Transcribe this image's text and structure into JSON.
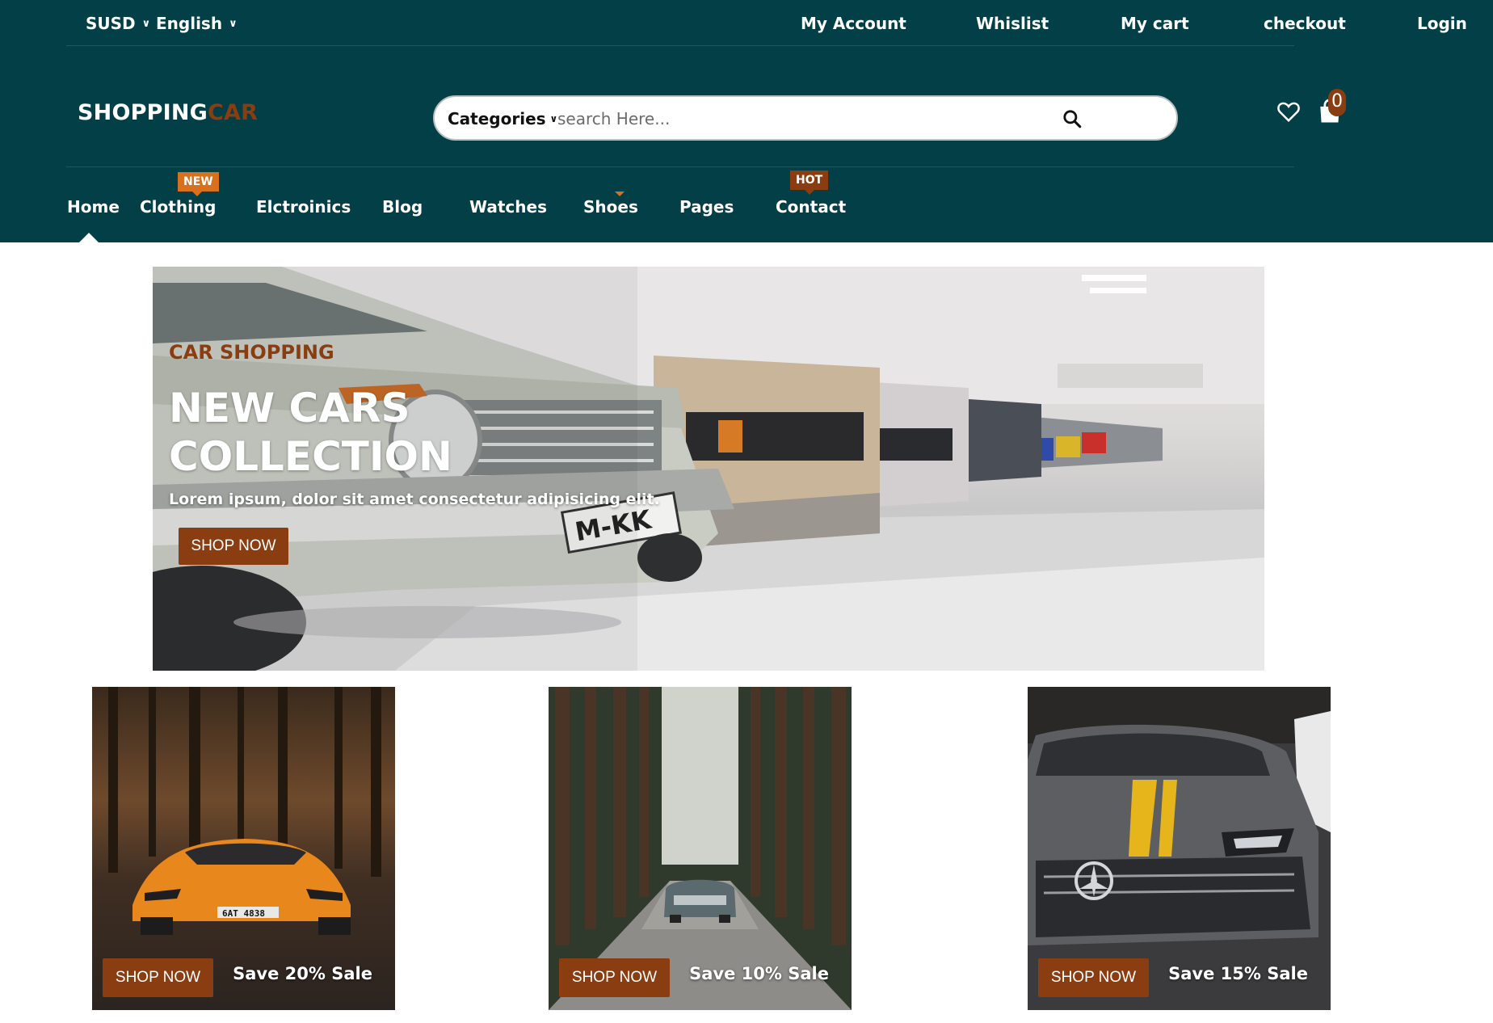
{
  "topbar": {
    "currency": "SUSD",
    "language": "English",
    "links": [
      "My Account",
      "Whislist",
      "My cart",
      "checkout",
      "Login"
    ]
  },
  "logo": {
    "part1": "SHOPPING",
    "part2": "CAR"
  },
  "search": {
    "category_label": "Categories",
    "placeholder": "search Here..."
  },
  "cart": {
    "count": "0"
  },
  "nav": {
    "items": [
      "Home",
      "Clothing",
      "Elctroinics",
      "Blog",
      "Watches",
      "Shoes",
      "Pages",
      "Contact"
    ],
    "new_tag": "NEW",
    "hot_tag": "HOT"
  },
  "hero": {
    "subtitle": "CAR SHOPPING",
    "title_line1": "NEW CARS",
    "title_line2": "COLLECTION",
    "text": "Lorem ipsum, dolor sit amet consectetur adipisicing elit.",
    "button": "SHOP NOW",
    "plate": "M-KK"
  },
  "cards": [
    {
      "button": "SHOP NOW",
      "sale": "Save 20% Sale",
      "plate": "6AT 4838"
    },
    {
      "button": "SHOP NOW",
      "sale": "Save 10% Sale"
    },
    {
      "button": "SHOP NOW",
      "sale": "Save 15% Sale"
    }
  ],
  "colors": {
    "header_bg": "#033f47",
    "accent_brown": "#8a3d10",
    "accent_orange": "#d9701b"
  },
  "icons": [
    "chevron-down-icon",
    "search-icon",
    "heart-icon",
    "shopping-bag-icon"
  ]
}
